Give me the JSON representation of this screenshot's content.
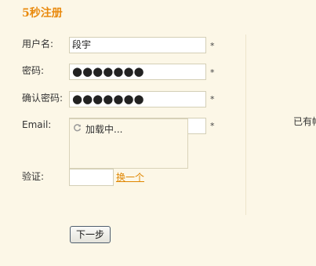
{
  "form": {
    "title": "5秒注册",
    "username": {
      "label": "用户名:",
      "value": "段宇",
      "required_mark": "*"
    },
    "password": {
      "label": "密码:",
      "value": "●●●●●●●",
      "required_mark": "*"
    },
    "confirm_password": {
      "label": "确认密码:",
      "value": "●●●●●●●",
      "required_mark": "*"
    },
    "email": {
      "label": "Email:",
      "value": "",
      "required_mark": "*"
    },
    "captcha": {
      "loading_text": "加载中...",
      "loading_icon": "refresh-icon"
    },
    "verify": {
      "label": "验证:",
      "value": "",
      "refresh_link": "换一个"
    },
    "next_button": "下一步"
  },
  "side": {
    "text": "已有帐号"
  },
  "colors": {
    "background": "#FCF7E7",
    "accent": "#E98A0E",
    "link": "#E08600"
  }
}
